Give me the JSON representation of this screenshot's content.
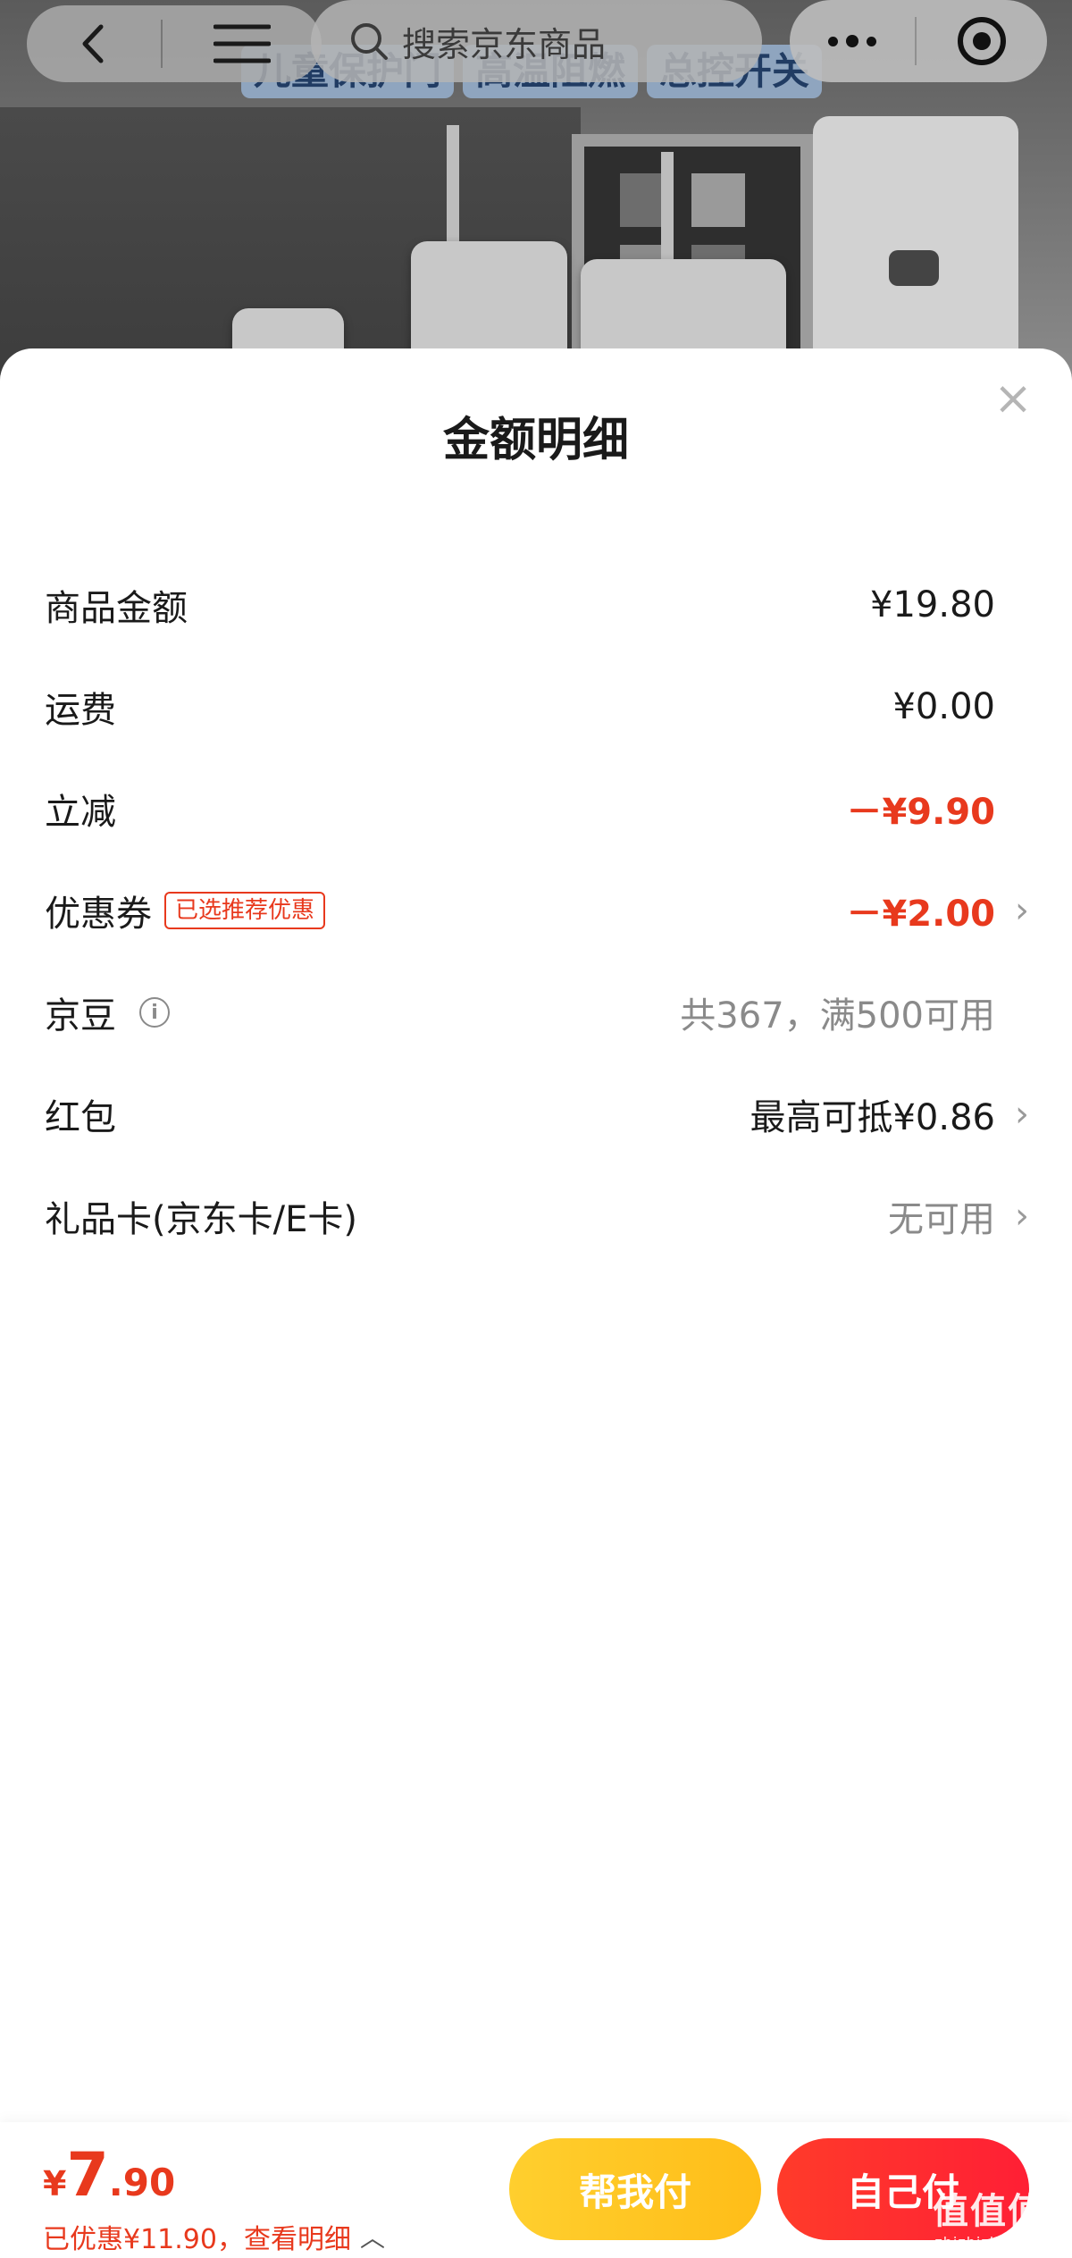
{
  "nav": {
    "search_placeholder": "搜索京东商品"
  },
  "background": {
    "tags": [
      "儿童保护门",
      "高温阻燃",
      "总控开关"
    ]
  },
  "sheet": {
    "title": "金额明细",
    "close_glyph": "×",
    "rows": [
      {
        "label": "商品金额",
        "value": "¥19.80"
      },
      {
        "label": "运费",
        "value": "¥0.00"
      },
      {
        "label": "立减",
        "value": "－¥9.90"
      },
      {
        "label": "优惠券",
        "tag": "已选推荐优惠",
        "value": "－¥2.00"
      },
      {
        "label": "京豆",
        "info_glyph": "i",
        "value": "共367，满500可用"
      },
      {
        "label": "红包",
        "value": "最高可抵¥0.86"
      },
      {
        "label": "礼品卡(京东卡/E卡)",
        "value": "无可用"
      }
    ],
    "chevron": "›"
  },
  "bottom": {
    "currency": "¥",
    "price_int": "7",
    "price_dec": ".90",
    "saved_text": "已优惠¥11.90，查看明细",
    "up_glyph": "︿",
    "help_pay_label": "帮我付",
    "self_pay_label": "自己付"
  },
  "watermark": {
    "main": "值值值",
    "sub": "zhizhizhi.com"
  },
  "colors": {
    "accent_red": "#e8391d",
    "help_button": "#ffc21f",
    "self_button": "#ff2a30"
  }
}
